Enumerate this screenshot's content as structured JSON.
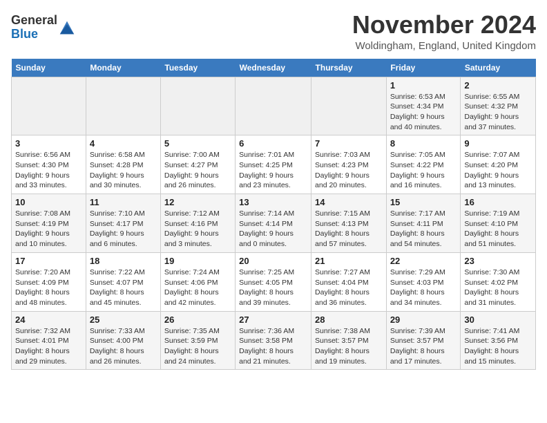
{
  "logo": {
    "line1": "General",
    "line2": "Blue"
  },
  "title": "November 2024",
  "location": "Woldingham, England, United Kingdom",
  "days_of_week": [
    "Sunday",
    "Monday",
    "Tuesday",
    "Wednesday",
    "Thursday",
    "Friday",
    "Saturday"
  ],
  "weeks": [
    [
      {
        "day": "",
        "info": ""
      },
      {
        "day": "",
        "info": ""
      },
      {
        "day": "",
        "info": ""
      },
      {
        "day": "",
        "info": ""
      },
      {
        "day": "",
        "info": ""
      },
      {
        "day": "1",
        "info": "Sunrise: 6:53 AM\nSunset: 4:34 PM\nDaylight: 9 hours and 40 minutes."
      },
      {
        "day": "2",
        "info": "Sunrise: 6:55 AM\nSunset: 4:32 PM\nDaylight: 9 hours and 37 minutes."
      }
    ],
    [
      {
        "day": "3",
        "info": "Sunrise: 6:56 AM\nSunset: 4:30 PM\nDaylight: 9 hours and 33 minutes."
      },
      {
        "day": "4",
        "info": "Sunrise: 6:58 AM\nSunset: 4:28 PM\nDaylight: 9 hours and 30 minutes."
      },
      {
        "day": "5",
        "info": "Sunrise: 7:00 AM\nSunset: 4:27 PM\nDaylight: 9 hours and 26 minutes."
      },
      {
        "day": "6",
        "info": "Sunrise: 7:01 AM\nSunset: 4:25 PM\nDaylight: 9 hours and 23 minutes."
      },
      {
        "day": "7",
        "info": "Sunrise: 7:03 AM\nSunset: 4:23 PM\nDaylight: 9 hours and 20 minutes."
      },
      {
        "day": "8",
        "info": "Sunrise: 7:05 AM\nSunset: 4:22 PM\nDaylight: 9 hours and 16 minutes."
      },
      {
        "day": "9",
        "info": "Sunrise: 7:07 AM\nSunset: 4:20 PM\nDaylight: 9 hours and 13 minutes."
      }
    ],
    [
      {
        "day": "10",
        "info": "Sunrise: 7:08 AM\nSunset: 4:19 PM\nDaylight: 9 hours and 10 minutes."
      },
      {
        "day": "11",
        "info": "Sunrise: 7:10 AM\nSunset: 4:17 PM\nDaylight: 9 hours and 6 minutes."
      },
      {
        "day": "12",
        "info": "Sunrise: 7:12 AM\nSunset: 4:16 PM\nDaylight: 9 hours and 3 minutes."
      },
      {
        "day": "13",
        "info": "Sunrise: 7:14 AM\nSunset: 4:14 PM\nDaylight: 9 hours and 0 minutes."
      },
      {
        "day": "14",
        "info": "Sunrise: 7:15 AM\nSunset: 4:13 PM\nDaylight: 8 hours and 57 minutes."
      },
      {
        "day": "15",
        "info": "Sunrise: 7:17 AM\nSunset: 4:11 PM\nDaylight: 8 hours and 54 minutes."
      },
      {
        "day": "16",
        "info": "Sunrise: 7:19 AM\nSunset: 4:10 PM\nDaylight: 8 hours and 51 minutes."
      }
    ],
    [
      {
        "day": "17",
        "info": "Sunrise: 7:20 AM\nSunset: 4:09 PM\nDaylight: 8 hours and 48 minutes."
      },
      {
        "day": "18",
        "info": "Sunrise: 7:22 AM\nSunset: 4:07 PM\nDaylight: 8 hours and 45 minutes."
      },
      {
        "day": "19",
        "info": "Sunrise: 7:24 AM\nSunset: 4:06 PM\nDaylight: 8 hours and 42 minutes."
      },
      {
        "day": "20",
        "info": "Sunrise: 7:25 AM\nSunset: 4:05 PM\nDaylight: 8 hours and 39 minutes."
      },
      {
        "day": "21",
        "info": "Sunrise: 7:27 AM\nSunset: 4:04 PM\nDaylight: 8 hours and 36 minutes."
      },
      {
        "day": "22",
        "info": "Sunrise: 7:29 AM\nSunset: 4:03 PM\nDaylight: 8 hours and 34 minutes."
      },
      {
        "day": "23",
        "info": "Sunrise: 7:30 AM\nSunset: 4:02 PM\nDaylight: 8 hours and 31 minutes."
      }
    ],
    [
      {
        "day": "24",
        "info": "Sunrise: 7:32 AM\nSunset: 4:01 PM\nDaylight: 8 hours and 29 minutes."
      },
      {
        "day": "25",
        "info": "Sunrise: 7:33 AM\nSunset: 4:00 PM\nDaylight: 8 hours and 26 minutes."
      },
      {
        "day": "26",
        "info": "Sunrise: 7:35 AM\nSunset: 3:59 PM\nDaylight: 8 hours and 24 minutes."
      },
      {
        "day": "27",
        "info": "Sunrise: 7:36 AM\nSunset: 3:58 PM\nDaylight: 8 hours and 21 minutes."
      },
      {
        "day": "28",
        "info": "Sunrise: 7:38 AM\nSunset: 3:57 PM\nDaylight: 8 hours and 19 minutes."
      },
      {
        "day": "29",
        "info": "Sunrise: 7:39 AM\nSunset: 3:57 PM\nDaylight: 8 hours and 17 minutes."
      },
      {
        "day": "30",
        "info": "Sunrise: 7:41 AM\nSunset: 3:56 PM\nDaylight: 8 hours and 15 minutes."
      }
    ]
  ]
}
